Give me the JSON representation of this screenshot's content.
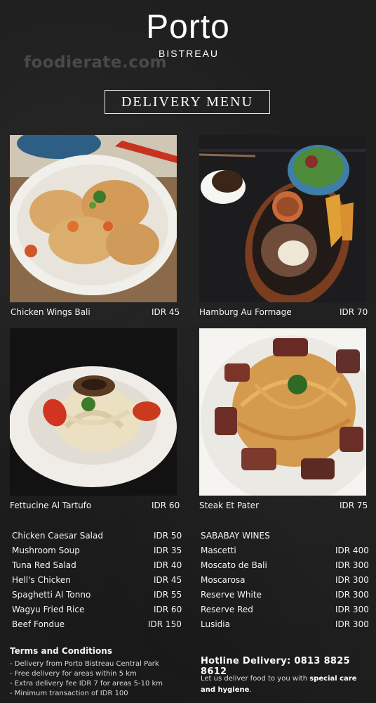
{
  "brand": {
    "name": "Porto",
    "sub": "BISTREAU",
    "watermark": "foodierate.com"
  },
  "title": "DELIVERY MENU",
  "featured": [
    {
      "name": "Chicken Wings Bali",
      "price": "IDR 45"
    },
    {
      "name": "Hamburg Au Formage",
      "price": "IDR 70"
    },
    {
      "name": "Fettucine Al Tartufo",
      "price": "IDR 60"
    },
    {
      "name": "Steak Et Pater",
      "price": "IDR 75"
    }
  ],
  "menu_left": [
    {
      "name": "Chicken Caesar Salad",
      "price": "IDR 50"
    },
    {
      "name": "Mushroom Soup",
      "price": "IDR 35"
    },
    {
      "name": "Tuna Red Salad",
      "price": "IDR 40"
    },
    {
      "name": "Hell's Chicken",
      "price": "IDR 45"
    },
    {
      "name": "Spaghetti Al Tonno",
      "price": "IDR 55"
    },
    {
      "name": "Wagyu Fried Rice",
      "price": "IDR 60"
    },
    {
      "name": "Beef Fondue",
      "price": "IDR 150"
    }
  ],
  "wines": {
    "heading": "SABABAY WINES",
    "items": [
      {
        "name": "Mascetti",
        "price": "IDR 400"
      },
      {
        "name": "Moscato de Bali",
        "price": "IDR 300"
      },
      {
        "name": "Moscarosa",
        "price": "IDR 300"
      },
      {
        "name": "Reserve White",
        "price": "IDR 300"
      },
      {
        "name": "Reserve Red",
        "price": "IDR 300"
      },
      {
        "name": "Lusidia",
        "price": "IDR 300"
      }
    ]
  },
  "terms": {
    "title": "Terms and Conditions",
    "lines": [
      "- Delivery from Porto Bistreau Central Park",
      "- Free delivery for areas within 5 km",
      "- Extra delivery fee IDR 7 for areas 5-10 km",
      "- Minimum transaction of IDR 100"
    ]
  },
  "hotline": "Hotline Delivery: 0813 8825 8612",
  "tagline": {
    "pre": "Let us deliver food to you with ",
    "emphasis": "special care and hygiene",
    "post": "."
  }
}
